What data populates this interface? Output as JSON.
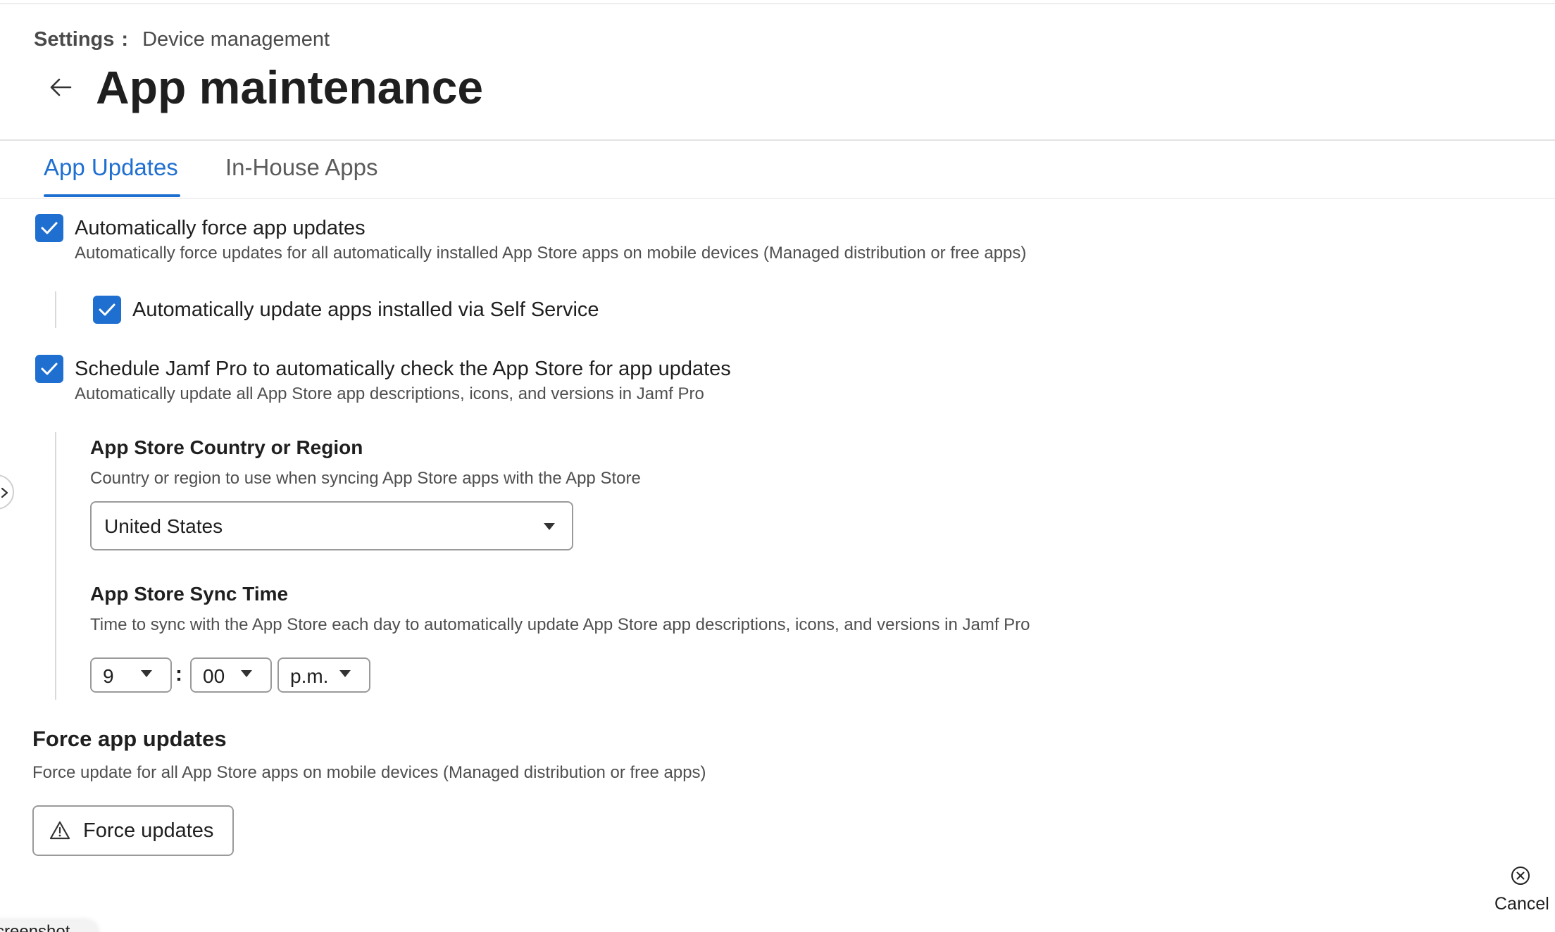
{
  "breadcrumb": {
    "root": "Settings",
    "separator": ":",
    "current": "Device management"
  },
  "page": {
    "title": "App maintenance",
    "back_icon": "arrow-left-icon"
  },
  "tabs": [
    {
      "label": "App Updates",
      "active": true
    },
    {
      "label": "In-House Apps",
      "active": false
    }
  ],
  "options": {
    "auto_force": {
      "label": "Automatically force app updates",
      "description": "Automatically force updates for all automatically installed App Store apps on mobile devices (Managed distribution or free apps)",
      "checked": true
    },
    "self_service": {
      "label": "Automatically update apps installed via Self Service",
      "checked": true
    },
    "schedule": {
      "label": "Schedule Jamf Pro to automatically check the App Store for app updates",
      "description": "Automatically update all App Store app descriptions, icons, and versions in Jamf Pro",
      "checked": true
    }
  },
  "country": {
    "heading": "App Store Country or Region",
    "description": "Country or region to use when syncing App Store apps with the App Store",
    "value": "United States"
  },
  "sync_time": {
    "heading": "App Store Sync Time",
    "description": "Time to sync with the App Store each day to automatically update App Store app descriptions, icons, and versions in Jamf Pro",
    "hour": "9",
    "separator": ":",
    "minute": "00",
    "period": "p.m."
  },
  "force": {
    "heading": "Force app updates",
    "description": "Force update for all App Store apps on mobile devices (Managed distribution or free apps)",
    "button_label": "Force updates",
    "button_icon": "warning-icon"
  },
  "footer": {
    "cancel_label": "Cancel",
    "cancel_icon": "close-circle-icon"
  },
  "overlay": {
    "screenshot_chip_label": "creenshot"
  },
  "colors": {
    "accent": "#1f6fd1"
  }
}
